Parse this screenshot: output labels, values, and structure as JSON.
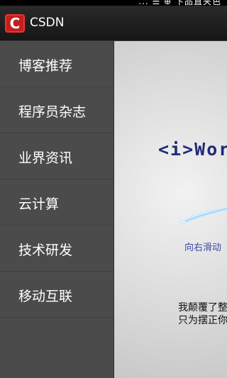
{
  "status_bar": {
    "fragment": "... ☰ ⊕ 卞品直夹色"
  },
  "app": {
    "title": "CSDN",
    "logo_letter": "C"
  },
  "drawer": {
    "items": [
      {
        "label": "博客推荐"
      },
      {
        "label": "程序员杂志"
      },
      {
        "label": "业界资讯"
      },
      {
        "label": "云计算"
      },
      {
        "label": "技术研发"
      },
      {
        "label": "移动互联"
      }
    ]
  },
  "content": {
    "logo_text": "<i>Wor",
    "swipe_hint": "向右滑动",
    "copy_line1": "我颠覆了整",
    "copy_line2": "只为摆正你"
  },
  "colors": {
    "titlebar": "#1f1f1f",
    "drawer": "#4b4b4b",
    "logo_red": "#c41e1e",
    "accent_blue": "#1f2b77"
  }
}
